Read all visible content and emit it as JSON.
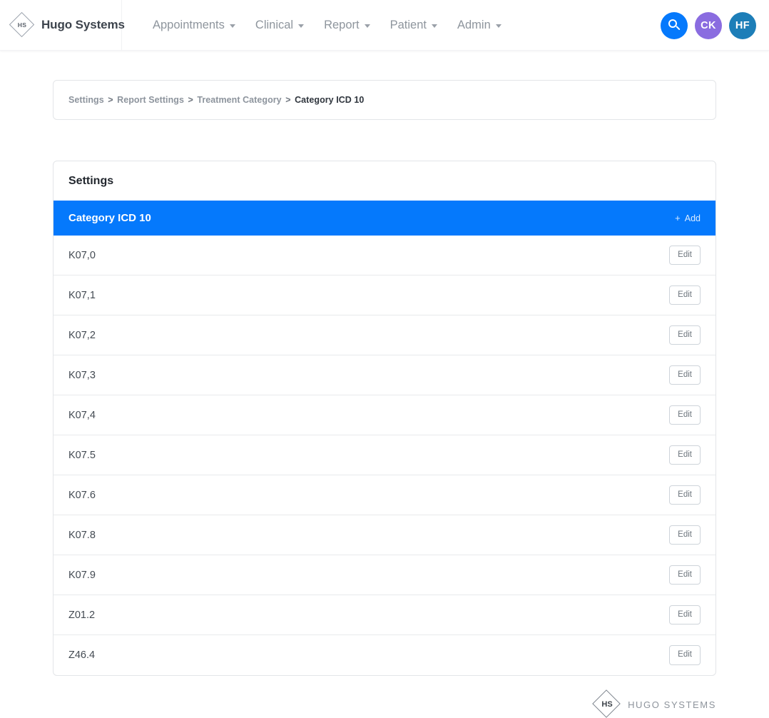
{
  "header": {
    "brand_name": "Hugo Systems",
    "brand_mark_text": "HS",
    "nav_items": [
      {
        "label": "Appointments"
      },
      {
        "label": "Clinical"
      },
      {
        "label": "Report"
      },
      {
        "label": "Patient"
      },
      {
        "label": "Admin"
      }
    ],
    "actions": {
      "search_icon": "search-icon",
      "avatars": [
        {
          "initials": "CK",
          "color": "#8a6ce0"
        },
        {
          "initials": "HF",
          "color": "#1d7eb8"
        }
      ]
    },
    "accent_color": "#0579fc"
  },
  "breadcrumb": {
    "items": [
      {
        "label": "Settings",
        "current": false
      },
      {
        "label": "Report Settings",
        "current": false
      },
      {
        "label": "Treatment Category",
        "current": false
      },
      {
        "label": "Category ICD 10",
        "current": true
      }
    ],
    "separator": ">"
  },
  "panel": {
    "title": "Settings",
    "section_title": "Category ICD 10",
    "add_label": "Add",
    "add_plus": "+",
    "row_action_label": "Edit",
    "rows": [
      {
        "code": "K07,0"
      },
      {
        "code": "K07,1"
      },
      {
        "code": "K07,2"
      },
      {
        "code": "K07,3"
      },
      {
        "code": "K07,4"
      },
      {
        "code": "K07.5"
      },
      {
        "code": "K07.6"
      },
      {
        "code": "K07.8"
      },
      {
        "code": "K07.9"
      },
      {
        "code": "Z01.2"
      },
      {
        "code": "Z46.4"
      }
    ]
  },
  "footer": {
    "mark_text": "HS",
    "brand_text": "HUGO SYSTEMS"
  }
}
